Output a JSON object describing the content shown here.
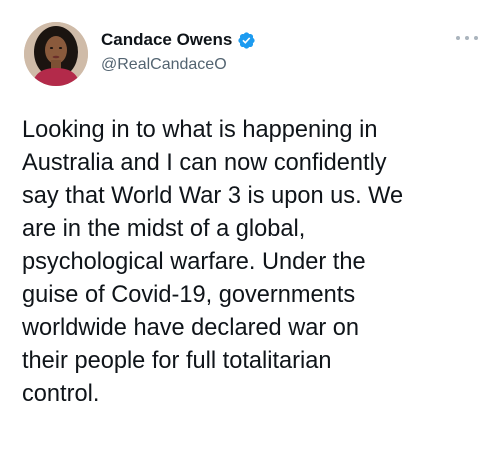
{
  "tweet": {
    "author": {
      "display_name": "Candace Owens",
      "handle": "@RealCandaceO",
      "verified": true,
      "avatar": "profile-photo"
    },
    "more_options_icon": "ellipsis-icon",
    "text": "Looking in to what is happening in\nAustralia and I can now confidently\nsay that World War 3 is upon us. We\nare in the midst of a global,\npsychological warfare. Under the\nguise of Covid-19, governments\nworldwide have declared war on\ntheir people for full totalitarian\ncontrol."
  },
  "colors": {
    "text": "#0f1419",
    "secondary": "#536471",
    "verified_blue": "#1d9bf0"
  }
}
